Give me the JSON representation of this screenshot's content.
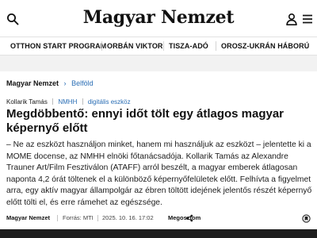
{
  "header": {
    "logo_text": "Magyar Nemzet",
    "search_icon": "search-icon",
    "user_icon": "user-icon",
    "menu_icon": "hamburger-menu-icon"
  },
  "nav": {
    "items": [
      {
        "label": "OTTHON START PROGRAM"
      },
      {
        "label": "ORBÁN VIKTOR"
      },
      {
        "label": "TISZA-ADÓ"
      },
      {
        "label": "OROSZ-UKRÁN HÁBORÚ"
      }
    ]
  },
  "breadcrumb": {
    "home": "Magyar Nemzet",
    "section": "Belföld"
  },
  "tags": {
    "person": "Kollarik Tamás",
    "org": "NMHH",
    "topic": "digitális eszköz"
  },
  "article": {
    "headline": "Megdöbbentő: ennyi időt tölt egy átlagos magyar képernyő előtt",
    "lead": "– Ne az eszközt használjon minket, hanem mi használjuk az eszközt – jelentette ki a MOME docense, az NMHH elnöki főtanácsadója. Kollarik Tamás az Alexandre Trauner Art/Film Fesztiválon (ATAFF) arról beszélt, a magyar emberek átlagosan naponta 4,2 órát töltenek el a különböző képernyőfelületek előtt. Felhívta a figyelmet arra, egy aktív magyar állampolgár az ébren töltött idejének jelentős részét képernyő előtt tölti el, és erre rámehet az egészsége."
  },
  "byline": {
    "author": "Magyar Nemzet",
    "source": "Forrás: MTI",
    "date": "2025. 10. 16. 17:02",
    "share_label": "Megosztom",
    "share_icon": "share-icon",
    "bookmark_icon": "bookmark-icon"
  }
}
